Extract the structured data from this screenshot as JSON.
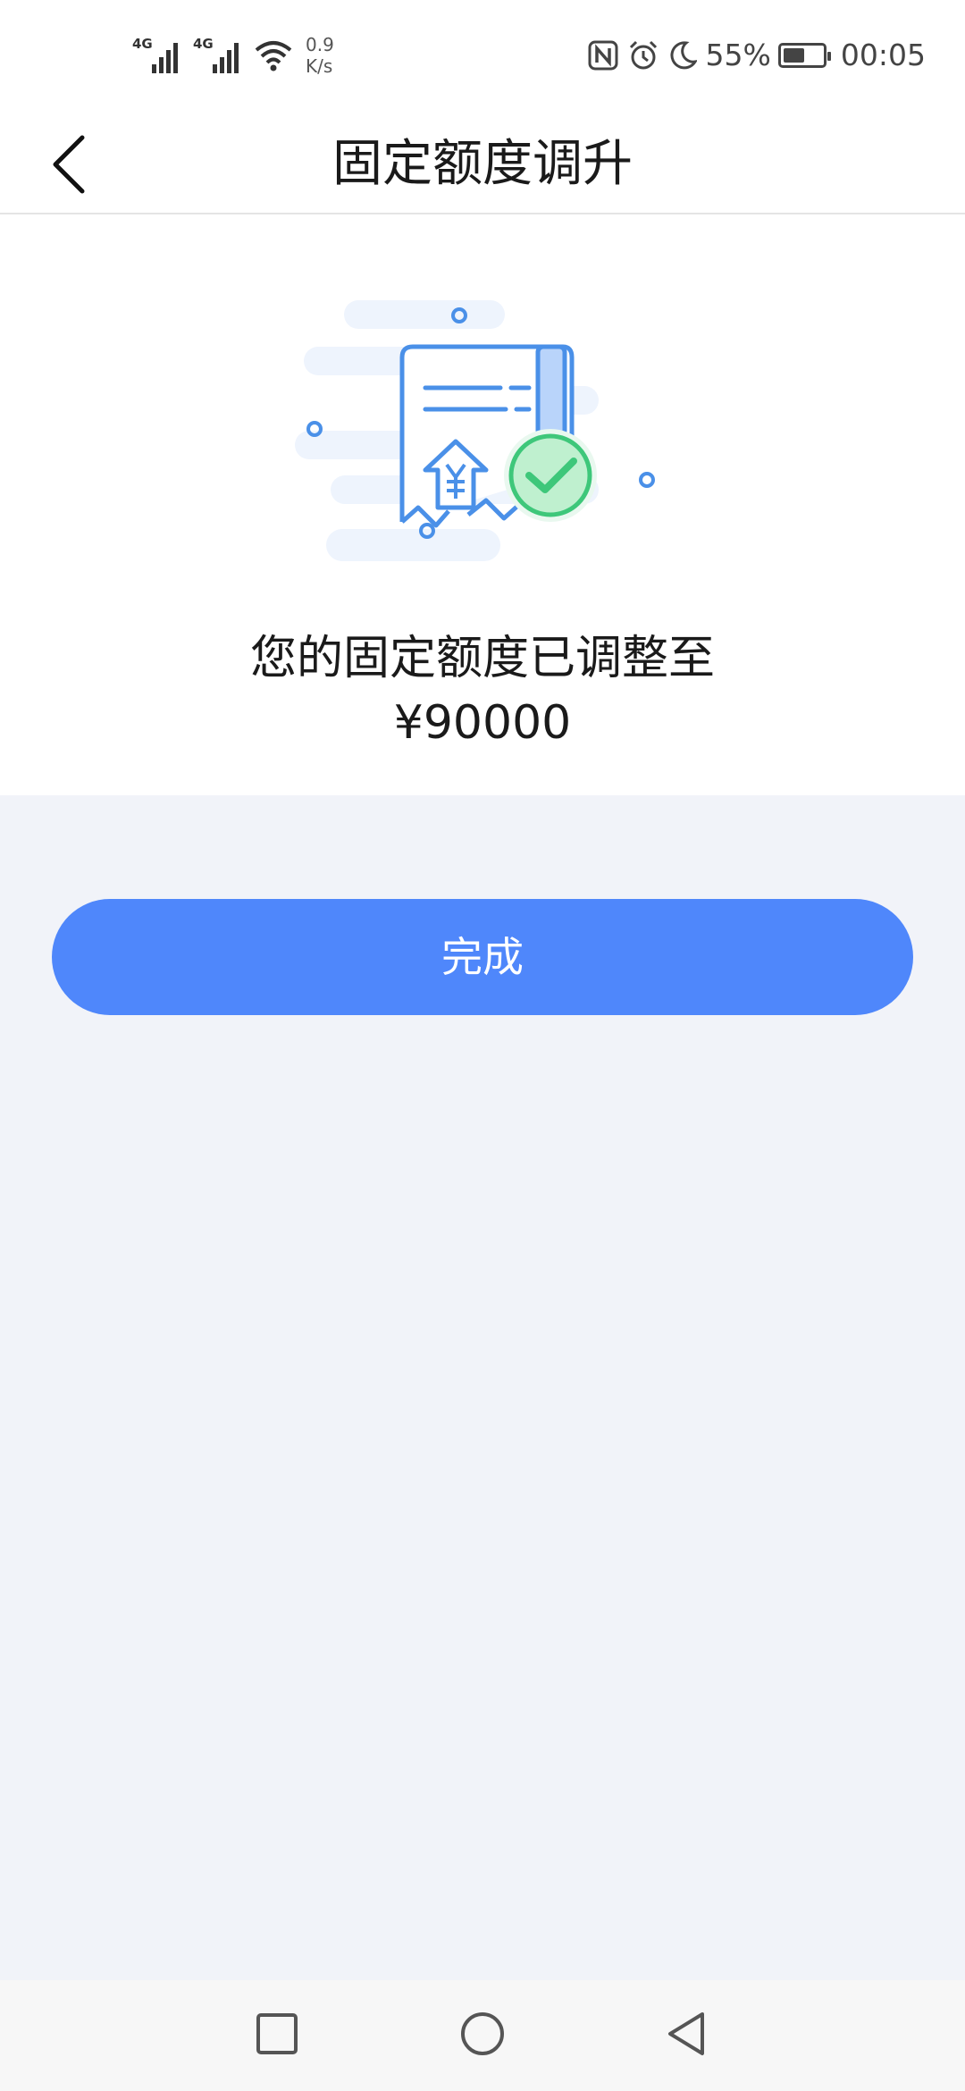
{
  "status_bar": {
    "network_1": "4G",
    "network_2": "4G",
    "speed_value": "0.9",
    "speed_unit": "K/s",
    "battery": "55%",
    "time": "00:05",
    "icons": [
      "nfc-icon",
      "alarm-icon",
      "moon-icon",
      "battery-icon"
    ]
  },
  "navbar": {
    "title": "固定额度调升"
  },
  "result": {
    "message": "您的固定额度已调整至",
    "amount": "¥90000"
  },
  "actions": {
    "done_label": "完成"
  },
  "colors": {
    "primary": "#4f87fb",
    "success": "#3ec77a",
    "page_bg": "#f1f3f9"
  }
}
